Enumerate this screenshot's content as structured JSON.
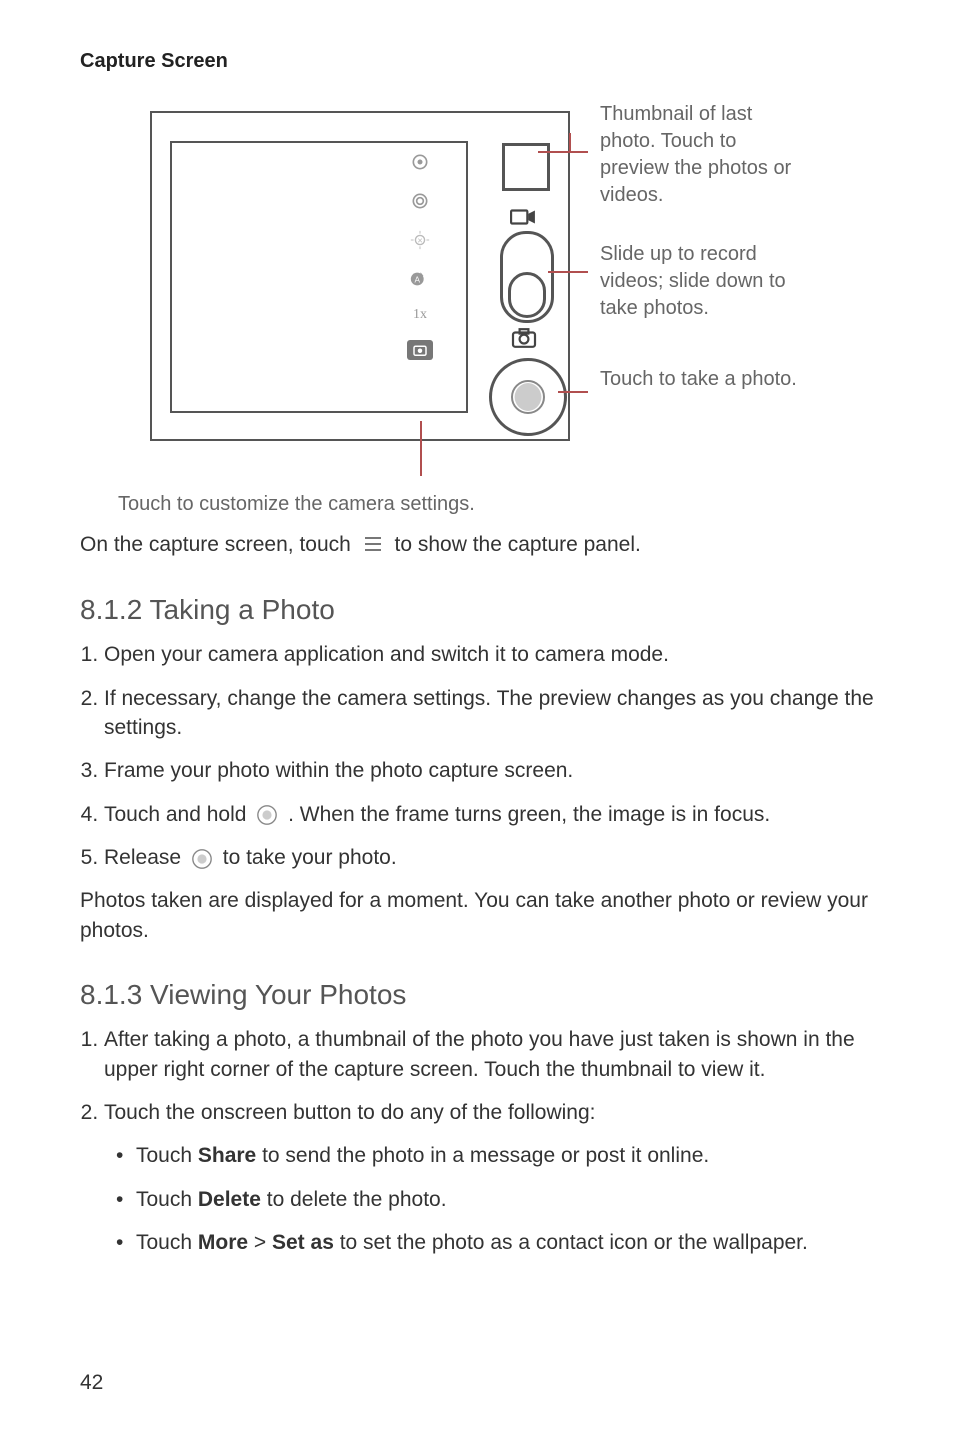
{
  "heading": "Capture Screen",
  "diagram": {
    "zoom_label": "1x",
    "callouts": {
      "thumbnail": "Thumbnail of last photo. Touch to preview the photos or videos.",
      "slider": "Slide up to record videos; slide down to take photos.",
      "shutter": "Touch to take a photo.",
      "bottom": "Touch to customize the camera settings."
    }
  },
  "intro_line_pre": "On the capture screen, touch ",
  "intro_line_post": " to show the capture panel.",
  "section_812_title": "8.1.2  Taking a Photo",
  "steps_812": [
    "Open your camera application and switch it to camera mode.",
    "If necessary, change the camera settings. The preview changes as you change the settings.",
    "Frame your photo within the photo capture screen.",
    {
      "pre": "Touch and hold ",
      "post": " . When the frame turns green, the image is in focus."
    },
    {
      "pre": "Release ",
      "post": " to take your photo."
    }
  ],
  "note_812": "Photos taken are displayed for a moment. You can take another photo or review your photos.",
  "section_813_title": "8.1.3  Viewing Your Photos",
  "steps_813": [
    "After taking a photo, a thumbnail of the photo you have just taken is shown in the upper right corner of the capture screen. Touch the thumbnail to view it.",
    "Touch the onscreen button to do any of the following:"
  ],
  "bullets_813": [
    {
      "pre": "Touch ",
      "bold": "Share",
      "post": " to send the photo in a message or post it online."
    },
    {
      "pre": "Touch ",
      "bold": "Delete",
      "post": " to delete the photo."
    },
    {
      "pre": "Touch ",
      "bold": "More",
      "mid": " > ",
      "bold2": "Set as",
      "post": " to set the photo as a contact icon or the wallpaper."
    }
  ],
  "page_number": "42"
}
